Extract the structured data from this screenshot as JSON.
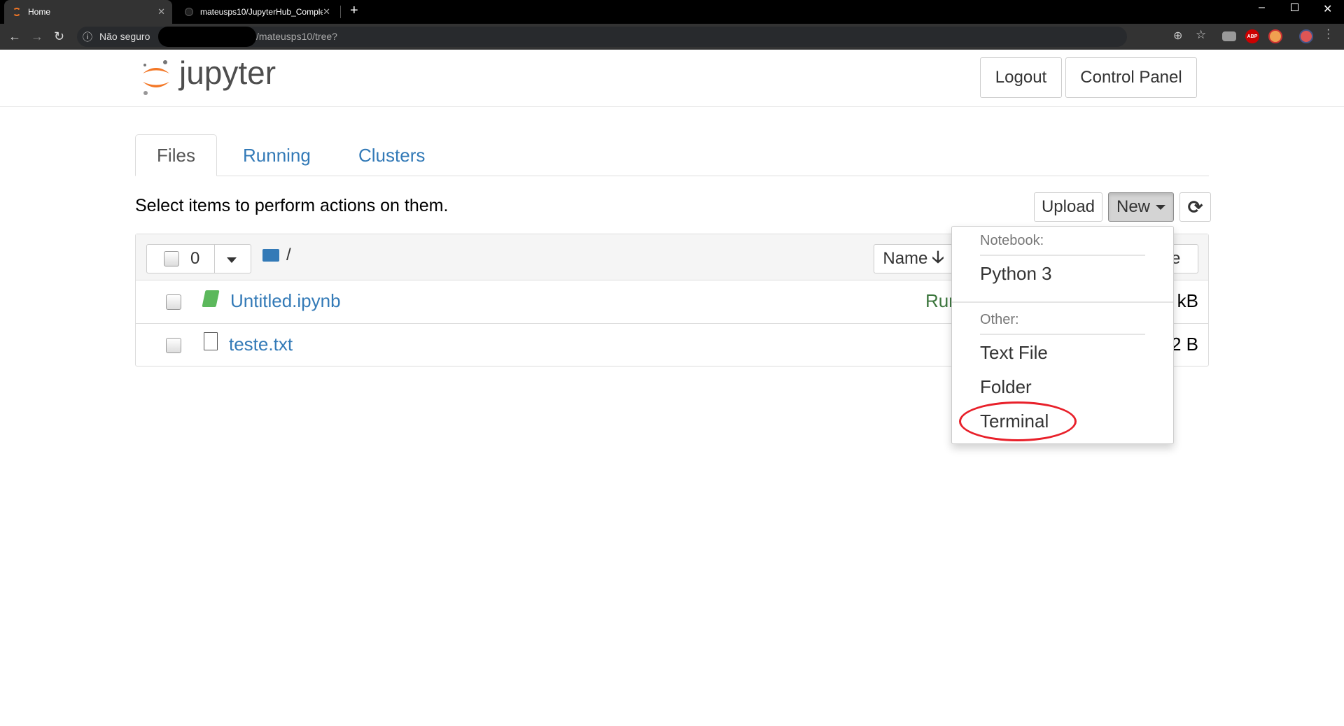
{
  "browser": {
    "tabs": [
      {
        "title": "Home",
        "active": true
      },
      {
        "title": "mateusps10/JupyterHub_Comple",
        "active": false
      }
    ],
    "security_label": "Não seguro",
    "url_suffix": "/mateusps10/tree?",
    "extensions": [
      "zoom-icon",
      "star-icon",
      "camera-icon",
      "adblock-icon",
      "extension-icon",
      "profile-avatar",
      "menu-icon"
    ]
  },
  "header": {
    "logo_text": "jupyter",
    "logout": "Logout",
    "control_panel": "Control Panel"
  },
  "tabs": [
    {
      "label": "Files",
      "active": true
    },
    {
      "label": "Running"
    },
    {
      "label": "Clusters"
    }
  ],
  "toolbar": {
    "instructions": "Select items to perform actions on them.",
    "upload": "Upload",
    "new": "New",
    "selected_count": "0",
    "path": "/"
  },
  "list": {
    "columns": {
      "name": "Name",
      "size": "Size"
    },
    "rows": [
      {
        "name": "Untitled.ipynb",
        "type": "notebook",
        "status": "Running",
        "size": "kB"
      },
      {
        "name": "teste.txt",
        "type": "file",
        "status": "",
        "size": "2 B"
      }
    ]
  },
  "new_menu": {
    "notebook_header": "Notebook:",
    "notebook_items": [
      "Python 3"
    ],
    "other_header": "Other:",
    "other_items": [
      "Text File",
      "Folder",
      "Terminal"
    ],
    "highlighted": "Terminal"
  },
  "colors": {
    "link": "#337ab7",
    "running": "#5cb85c",
    "jupyter_orange": "#f37726",
    "highlight_ring": "#e8202a"
  }
}
